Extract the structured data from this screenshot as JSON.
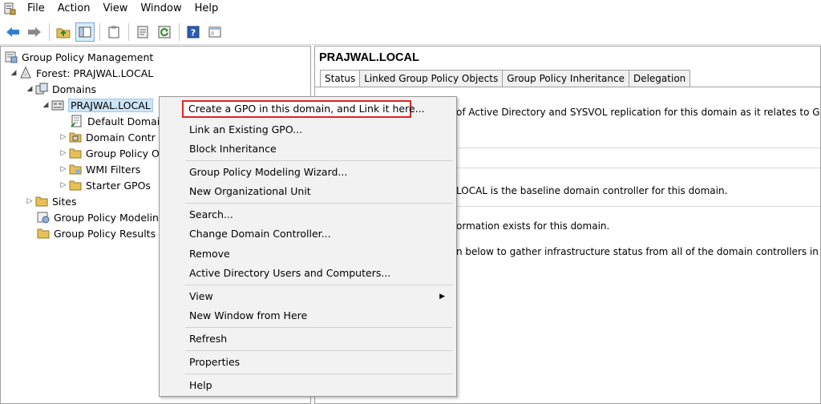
{
  "menubar": {
    "items": [
      "File",
      "Action",
      "View",
      "Window",
      "Help"
    ]
  },
  "tree": {
    "root": "Group Policy Management",
    "forest": "Forest: PRAJWAL.LOCAL",
    "domains": "Domains",
    "domain": "PRAJWAL.LOCAL",
    "default_domain": "Default Domai",
    "domain_controllers": "Domain Contr",
    "gpo": "Group Policy O",
    "wmi_filters": "WMI Filters",
    "starter_gpos": "Starter GPOs",
    "sites": "Sites",
    "modeling": "Group Policy Modelin",
    "results": "Group Policy Results"
  },
  "right": {
    "title": "PRAJWAL.LOCAL",
    "tabs": [
      "Status",
      "Linked Group Policy Objects",
      "Group Policy Inheritance",
      "Delegation"
    ],
    "lines": [
      "of Active Directory and SYSVOL replication for this domain as it relates to Group Policy.",
      "LOCAL is the baseline domain controller for this domain.",
      "ormation exists for this domain.",
      "n below to gather infrastructure status from all of the domain controllers in this domain."
    ]
  },
  "context_menu": {
    "items": [
      "Create a GPO in this domain, and Link it here...",
      "Link an Existing GPO...",
      "Block Inheritance",
      "Group Policy Modeling Wizard...",
      "New Organizational Unit",
      "Search...",
      "Change Domain Controller...",
      "Remove",
      "Active Directory Users and Computers...",
      "View",
      "New Window from Here",
      "Refresh",
      "Properties",
      "Help"
    ]
  },
  "colors": {
    "highlight_border": "#e02424",
    "selection": "#cce4f7"
  }
}
